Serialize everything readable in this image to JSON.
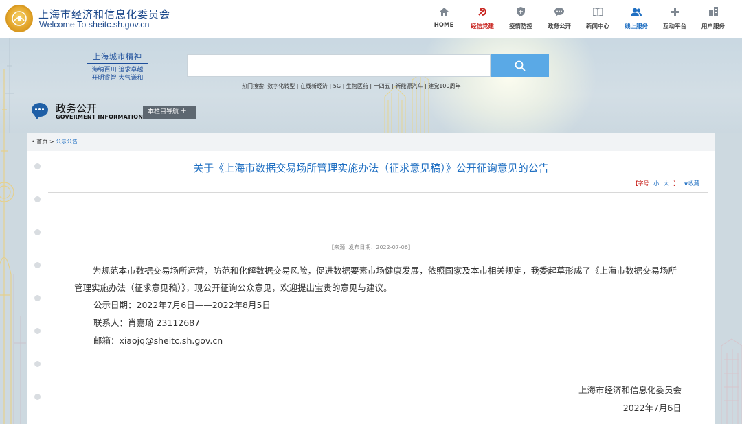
{
  "header": {
    "site_title": "上海市经济和信息化委员会",
    "site_subtitle": "Welcome To sheitc.sh.gov.cn",
    "nav": [
      {
        "label": "HOME",
        "icon": "home-icon"
      },
      {
        "label": "经信党建",
        "icon": "party-emblem-icon"
      },
      {
        "label": "疫情防控",
        "icon": "shield-icon"
      },
      {
        "label": "政务公开",
        "icon": "chat-bubble-icon"
      },
      {
        "label": "新闻中心",
        "icon": "news-book-icon"
      },
      {
        "label": "线上服务",
        "icon": "users-icon"
      },
      {
        "label": "互动平台",
        "icon": "grid-icon"
      },
      {
        "label": "用户服务",
        "icon": "building-icon"
      }
    ]
  },
  "banner": {
    "spirit_title": "上海城市精神",
    "spirit_line1": "海纳百川 追求卓越",
    "spirit_line2": "开明睿智 大气谦和",
    "search_placeholder": "",
    "hot_search": "热门搜索: 数字化转型 | 在线新经济 | 5G | 生物医药 | 十四五 | 新能源汽车 | 建党100周年"
  },
  "section": {
    "title": "政务公开",
    "title_en": "GOVERMENT INFORMATION",
    "column_nav": "本栏目导航 ＋"
  },
  "breadcrumb": {
    "home": "首页",
    "separator": ">",
    "current": "公示公告"
  },
  "article": {
    "title": "关于《上海市数据交易场所管理实施办法（征求意见稿）》公开征询意见的公告",
    "tools": {
      "open": "【字号",
      "small": "小",
      "large": "大",
      "close": "】",
      "favorite": "★收藏"
    },
    "meta": "【来源:    发布日期：2022-07-06】",
    "paragraph": "为规范本市数据交易场所运营，防范和化解数据交易风险，促进数据要素市场健康发展，依照国家及本市相关规定，我委起草形成了《上海市数据交易场所管理实施办法（征求意见稿）》，现公开征询公众意见，欢迎提出宝贵的意见与建议。",
    "period": "公示日期：2022年7月6日——2022年8月5日",
    "contact": "联系人：肖嘉琦  23112687",
    "email": "邮箱：xiaojq@sheitc.sh.gov.cn",
    "signature": "上海市经济和信息化委员会",
    "date": "2022年7月6日"
  },
  "colors": {
    "brand_blue": "#1f6fc2",
    "party_red": "#c8241f",
    "search_button": "#5aa9e6",
    "column_nav_bg": "#5d6770"
  }
}
